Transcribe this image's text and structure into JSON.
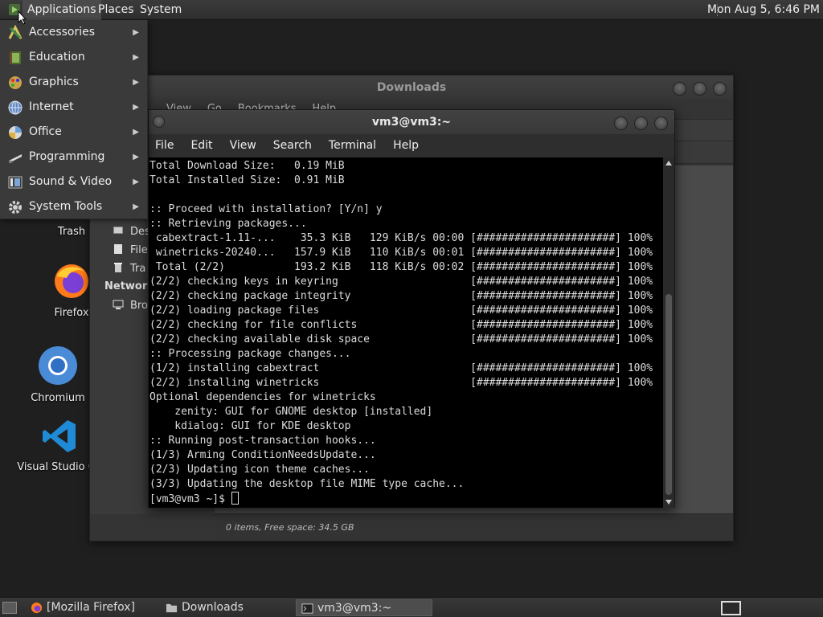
{
  "top_panel": {
    "menus": [
      "Applications",
      "Places",
      "System"
    ],
    "clock": "Mon Aug  5,  6:46 PM"
  },
  "app_menu": {
    "items": [
      {
        "label": "Accessories",
        "icon": "accessories-icon"
      },
      {
        "label": "Education",
        "icon": "education-icon"
      },
      {
        "label": "Graphics",
        "icon": "graphics-icon"
      },
      {
        "label": "Internet",
        "icon": "internet-icon"
      },
      {
        "label": "Office",
        "icon": "office-icon"
      },
      {
        "label": "Programming",
        "icon": "programming-icon"
      },
      {
        "label": "Sound & Video",
        "icon": "sound-video-icon"
      },
      {
        "label": "System Tools",
        "icon": "system-tools-icon"
      }
    ]
  },
  "desktop": {
    "icons": [
      "Trash",
      "Firefox",
      "Chromium",
      "Visual Studio Co"
    ]
  },
  "file_manager": {
    "title": "Downloads",
    "menubar": [
      "View",
      "Go",
      "Bookmarks",
      "Help"
    ],
    "sidebar": [
      "Des",
      "File",
      "Tra",
      "Network",
      "Bro"
    ],
    "status": "0 items, Free space: 34.5 GB"
  },
  "terminal": {
    "title": "vm3@vm3:~",
    "menubar": [
      "File",
      "Edit",
      "View",
      "Search",
      "Terminal",
      "Help"
    ],
    "lines": [
      "Total Download Size:   0.19 MiB",
      "Total Installed Size:  0.91 MiB",
      "",
      ":: Proceed with installation? [Y/n] y",
      ":: Retrieving packages...",
      " cabextract-1.11-...    35.3 KiB   129 KiB/s 00:00 [######################] 100%",
      " winetricks-20240...   157.9 KiB   110 KiB/s 00:01 [######################] 100%",
      " Total (2/2)           193.2 KiB   118 KiB/s 00:02 [######################] 100%",
      "(2/2) checking keys in keyring                     [######################] 100%",
      "(2/2) checking package integrity                   [######################] 100%",
      "(2/2) loading package files                        [######################] 100%",
      "(2/2) checking for file conflicts                  [######################] 100%",
      "(2/2) checking available disk space                [######################] 100%",
      ":: Processing package changes...",
      "(1/2) installing cabextract                        [######################] 100%",
      "(2/2) installing winetricks                        [######################] 100%",
      "Optional dependencies for winetricks",
      "    zenity: GUI for GNOME desktop [installed]",
      "    kdialog: GUI for KDE desktop",
      ":: Running post-transaction hooks...",
      "(1/3) Arming ConditionNeedsUpdate...",
      "(2/3) Updating icon theme caches...",
      "(3/3) Updating the desktop file MIME type cache..."
    ],
    "prompt": "[vm3@vm3 ~]$ "
  },
  "taskbar": {
    "tasks": [
      "[Mozilla Firefox]",
      "Downloads",
      "vm3@vm3:~"
    ]
  }
}
